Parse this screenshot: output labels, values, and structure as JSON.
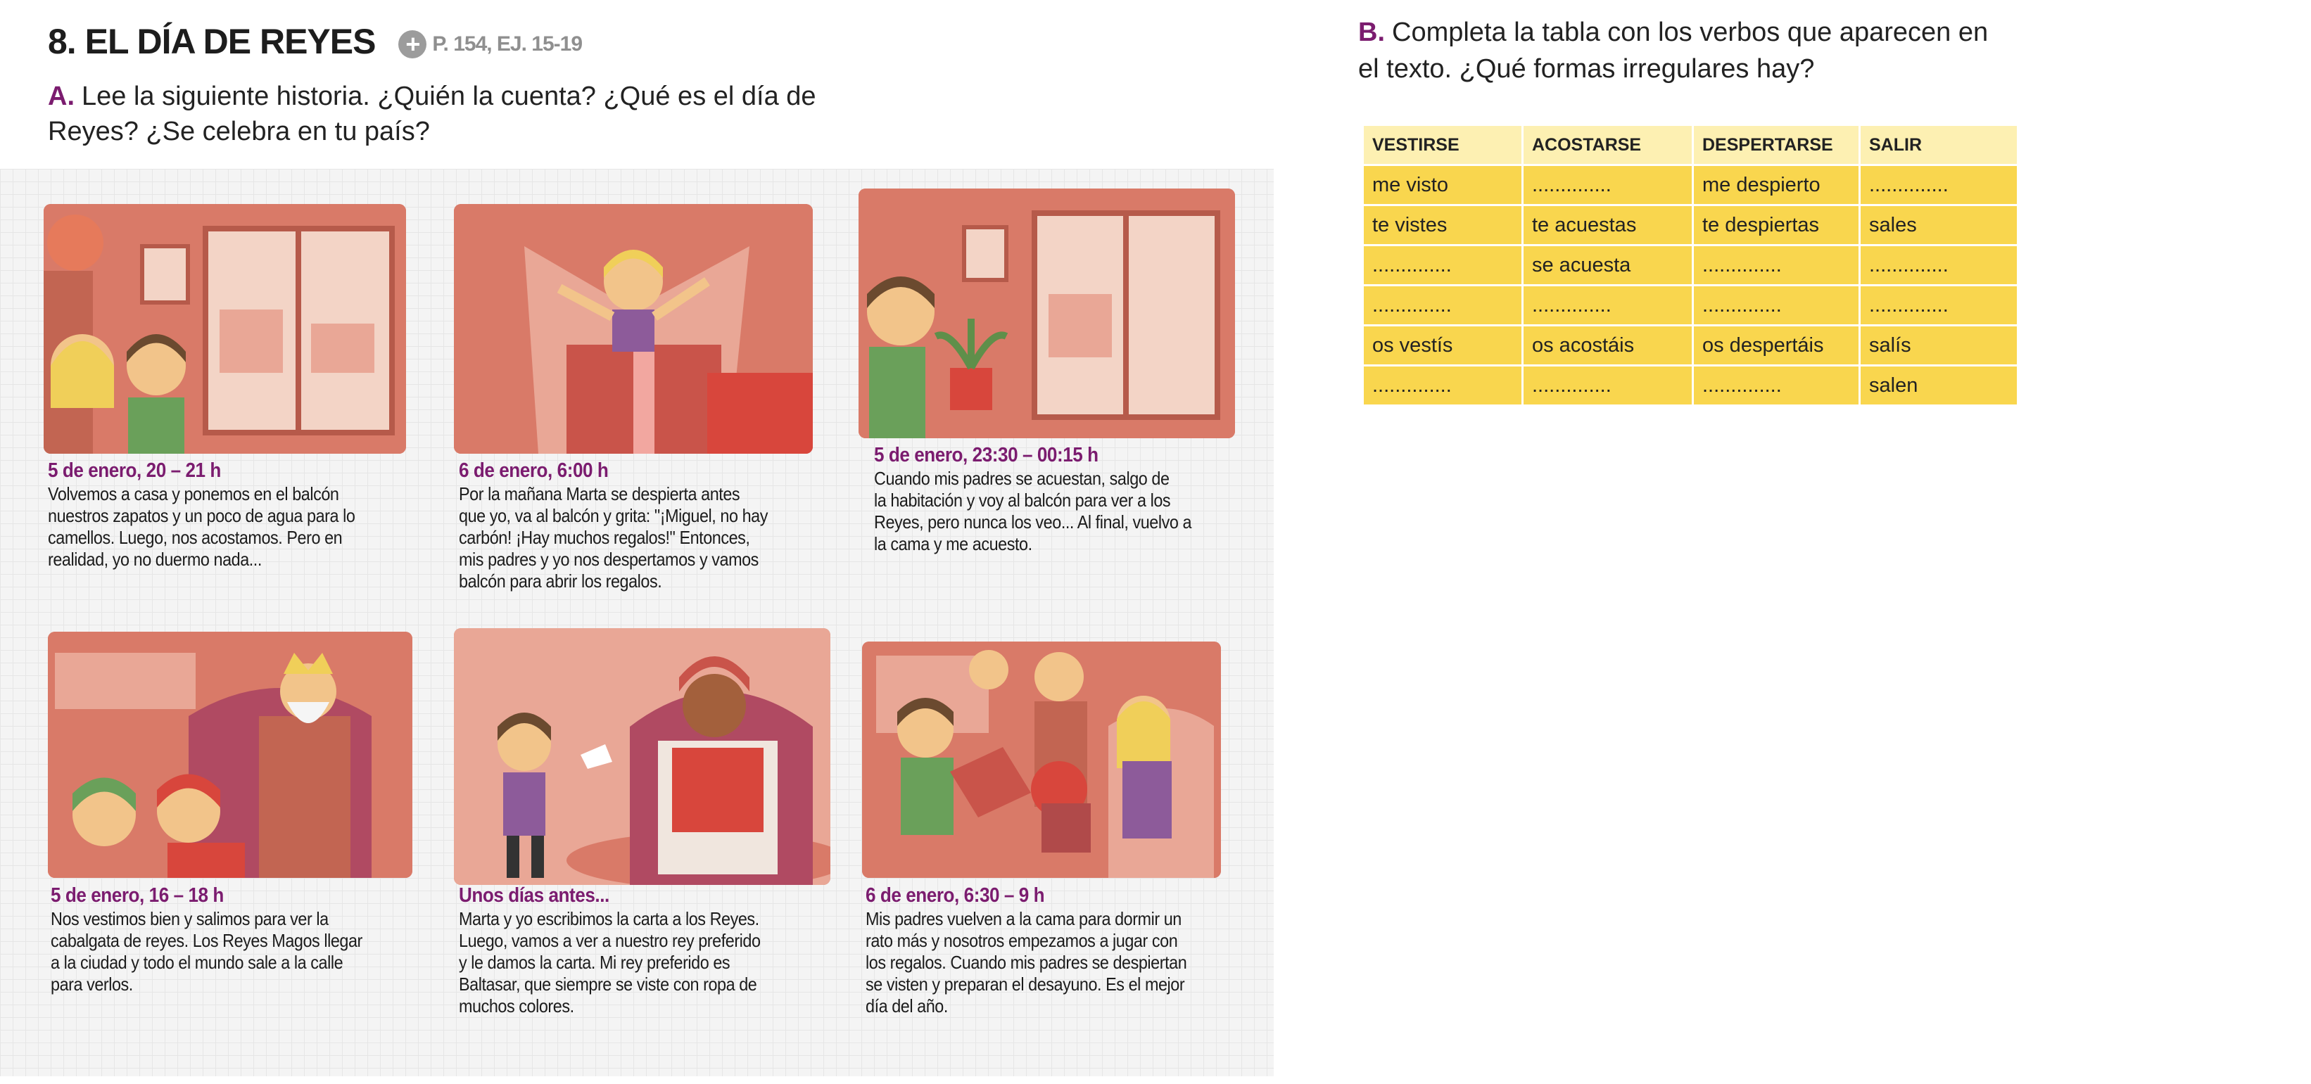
{
  "header": {
    "title": "8. EL DÍA DE REYES",
    "ref": "P. 154, EJ. 15-19"
  },
  "exerciseA": {
    "letter": "A.",
    "line1": "Lee la siguiente historia. ¿Quién la cuenta? ¿Qué es el día de",
    "line2": "Reyes? ¿Se celebra en tu país?"
  },
  "panels": [
    {
      "time": "5 de enero, 20 – 21 h",
      "lines": [
        "Volvemos a casa y ponemos en el balcón",
        "nuestros zapatos y un poco de agua para lo",
        "camellos. Luego, nos acostamos. Pero en",
        "realidad, yo no duermo nada..."
      ]
    },
    {
      "time": "6 de enero, 6:00 h",
      "lines": [
        "Por la mañana Marta se despierta antes",
        "que yo, va al balcón y grita: \"¡Miguel, no hay",
        "carbón! ¡Hay muchos regalos!\" Entonces,",
        "mis padres y yo nos despertamos y vamos",
        "balcón para abrir los regalos."
      ]
    },
    {
      "time": "5 de enero, 23:30 – 00:15 h",
      "lines": [
        "Cuando mis padres se acuestan, salgo de",
        "la habitación y voy al balcón para ver a los",
        "Reyes, pero nunca los veo... Al final, vuelvo a",
        "la cama y me acuesto."
      ]
    },
    {
      "time": "5 de enero, 16 – 18 h",
      "lines": [
        "Nos vestimos bien y salimos para ver la",
        "cabalgata de reyes. Los Reyes Magos llegar",
        "a la ciudad y todo el mundo sale a la calle",
        "para verlos."
      ]
    },
    {
      "time": "Unos días antes...",
      "lines": [
        "Marta y yo escribimos la carta a los Reyes.",
        "Luego, vamos a ver a nuestro rey preferido",
        "y le damos la carta. Mi rey preferido es",
        "Baltasar, que siempre se viste con ropa de",
        "muchos colores."
      ]
    },
    {
      "time": "6 de enero, 6:30 – 9 h",
      "lines": [
        "Mis padres vuelven a la cama para dormir un",
        "rato más y nosotros empezamos a jugar con",
        "los regalos. Cuando mis padres se despiertan",
        "se visten y preparan el desayuno. Es el mejor",
        "día del año."
      ]
    }
  ],
  "exerciseB": {
    "letter": "B.",
    "line1": "Completa la tabla con los verbos que aparecen en",
    "line2": "el texto. ¿Qué formas irregulares hay?"
  },
  "table": {
    "headers": [
      "VESTIRSE",
      "ACOSTARSE",
      "DESPERTARSE",
      "SALIR"
    ],
    "rows": [
      [
        "me visto",
        "..............",
        "me despierto",
        ".............."
      ],
      [
        "te vistes",
        "te acuestas",
        "te despiertas",
        "sales"
      ],
      [
        "..............",
        "se acuesta",
        "..............",
        ".............."
      ],
      [
        "..............",
        "..............",
        "..............",
        ".............."
      ],
      [
        "os vestís",
        "os acostáis",
        "os despertáis",
        "salís"
      ],
      [
        "..............",
        "..............",
        "..............",
        "salen"
      ]
    ]
  },
  "colors": {
    "accent": "#7b1c6f",
    "panel": "#d97a68",
    "tableHeader": "#fdf0b2",
    "tableCell": "#f9d64e"
  }
}
